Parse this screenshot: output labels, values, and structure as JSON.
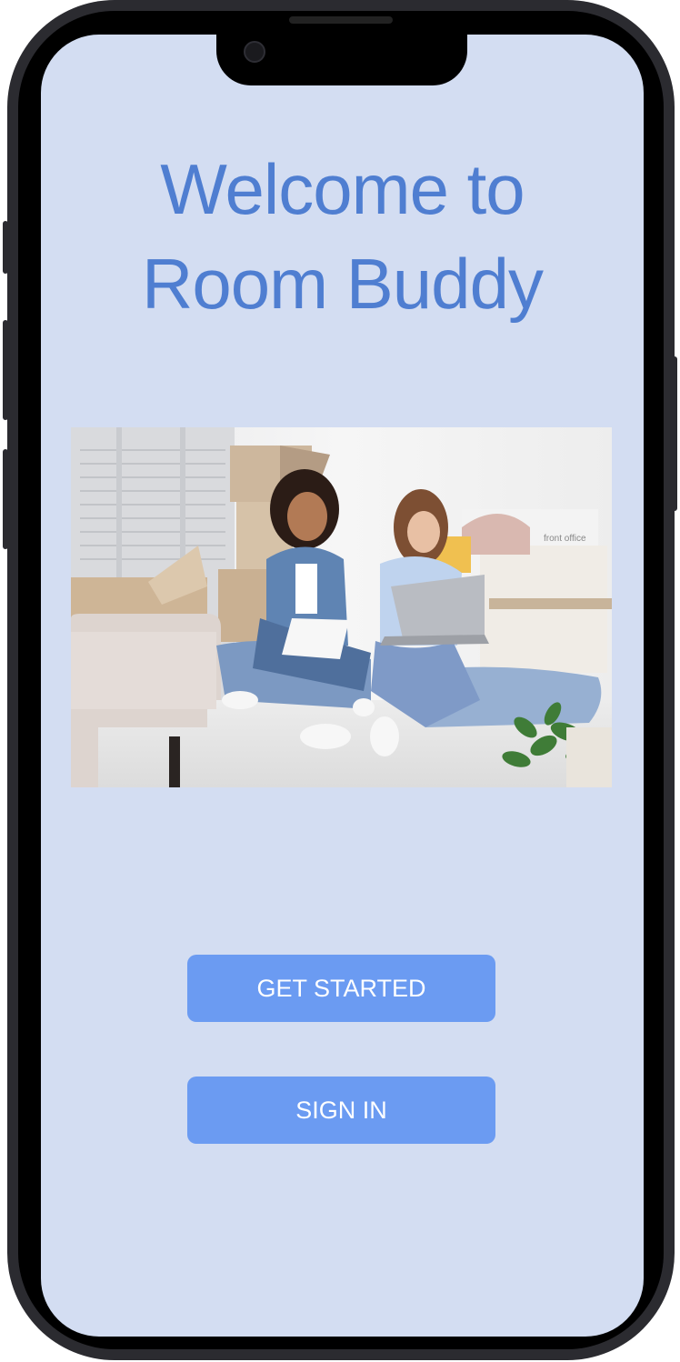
{
  "welcome": {
    "title_line1": "Welcome to",
    "title_line2": "Room Buddy"
  },
  "hero_image": {
    "icon": "roommates-photo"
  },
  "actions": {
    "get_started_label": "GET STARTED",
    "sign_in_label": "SIGN IN"
  },
  "colors": {
    "background": "#d3ddf2",
    "title": "#4f7ed1",
    "button": "#6b9bf2",
    "button_text": "#ffffff",
    "device_frame": "#2b2b30"
  }
}
